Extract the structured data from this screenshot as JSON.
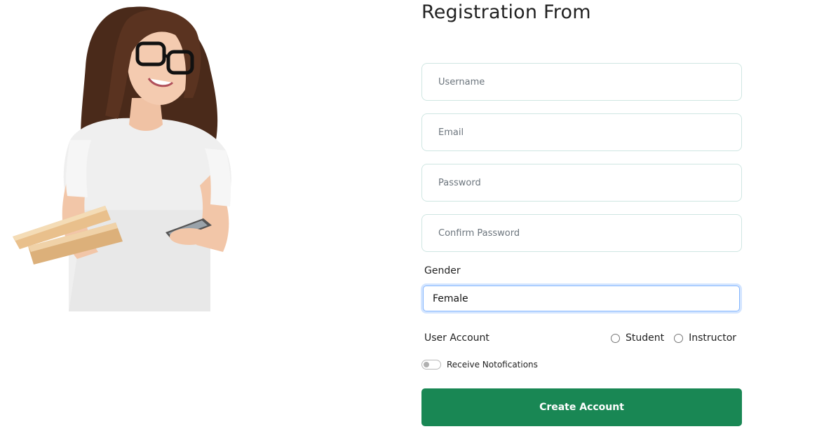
{
  "form": {
    "title": "Registration From",
    "username_placeholder": "Username",
    "email_placeholder": "Email",
    "password_placeholder": "Password",
    "confirm_password_placeholder": "Confirm Password",
    "gender_label": "Gender",
    "gender_selected": "Female",
    "user_account_label": "User Account",
    "account_options": [
      "Student",
      "Instructor"
    ],
    "notifications_label": "Receive Notofications",
    "notifications_enabled": false,
    "submit_label": "Create Account"
  },
  "colors": {
    "primary_button": "#198754",
    "field_border": "#cfe6e2",
    "focus_border": "#86b7fe"
  },
  "icons": {
    "hero": "woman-with-books-and-phone-illustration"
  }
}
